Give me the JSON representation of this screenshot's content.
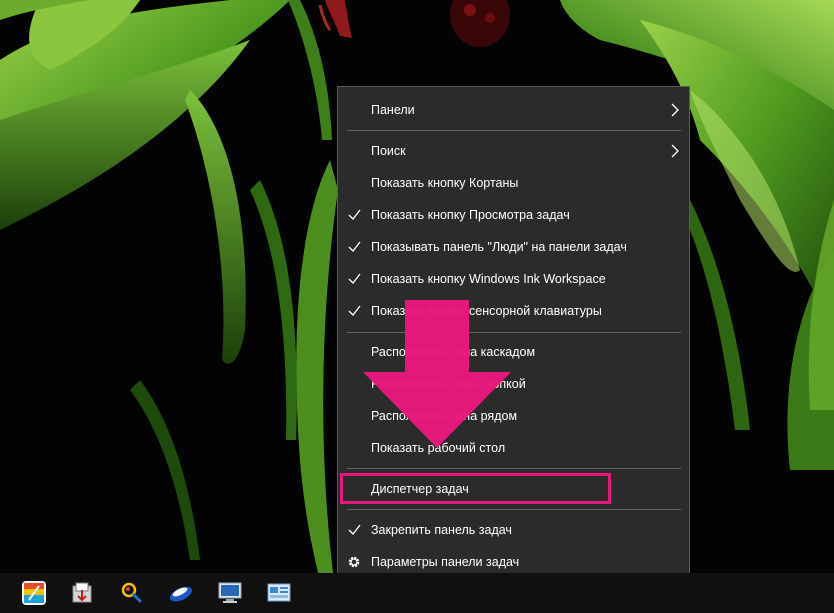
{
  "colors": {
    "menu_background": "#2b2b2b",
    "menu_text": "#ffffff",
    "separator": "#5f5f5f",
    "highlight": "#e8187d",
    "taskbar": "#101010"
  },
  "menu": {
    "items": [
      {
        "label": "Панели",
        "checked": false,
        "submenu": true,
        "icon": "chevron-right-icon"
      },
      {
        "label": "Поиск",
        "checked": false,
        "submenu": true,
        "icon": "chevron-right-icon"
      },
      {
        "label": "Показать кнопку Кортаны",
        "checked": false
      },
      {
        "label": "Показать кнопку Просмотра задач",
        "checked": true,
        "icon": "checkmark-icon"
      },
      {
        "label": "Показывать панель \"Люди\" на панели задач",
        "checked": true,
        "icon": "checkmark-icon"
      },
      {
        "label": "Показать кнопку Windows Ink Workspace",
        "checked": true,
        "icon": "checkmark-icon"
      },
      {
        "label": "Показать кнопку сенсорной клавиатуры",
        "checked": true,
        "icon": "checkmark-icon"
      },
      {
        "label": "Расположить окна каскадом",
        "checked": false
      },
      {
        "label": "Расположить окна стопкой",
        "checked": false
      },
      {
        "label": "Расположить окна рядом",
        "checked": false
      },
      {
        "label": "Показать рабочий стол",
        "checked": false
      },
      {
        "label": "Диспетчер задач",
        "checked": false,
        "highlighted": true
      },
      {
        "label": "Закрепить панель задач",
        "checked": true,
        "icon": "checkmark-icon"
      },
      {
        "label": "Параметры панели задач",
        "checked": false,
        "icon": "gear-icon"
      }
    ]
  },
  "taskbar": {
    "icons": [
      {
        "name": "bluestacks-app-icon"
      },
      {
        "name": "installer-app-icon"
      },
      {
        "name": "magnifier-tool-app-icon"
      },
      {
        "name": "blue-lens-app-icon"
      },
      {
        "name": "monitor-app-icon"
      },
      {
        "name": "control-panel-app-icon"
      }
    ]
  }
}
